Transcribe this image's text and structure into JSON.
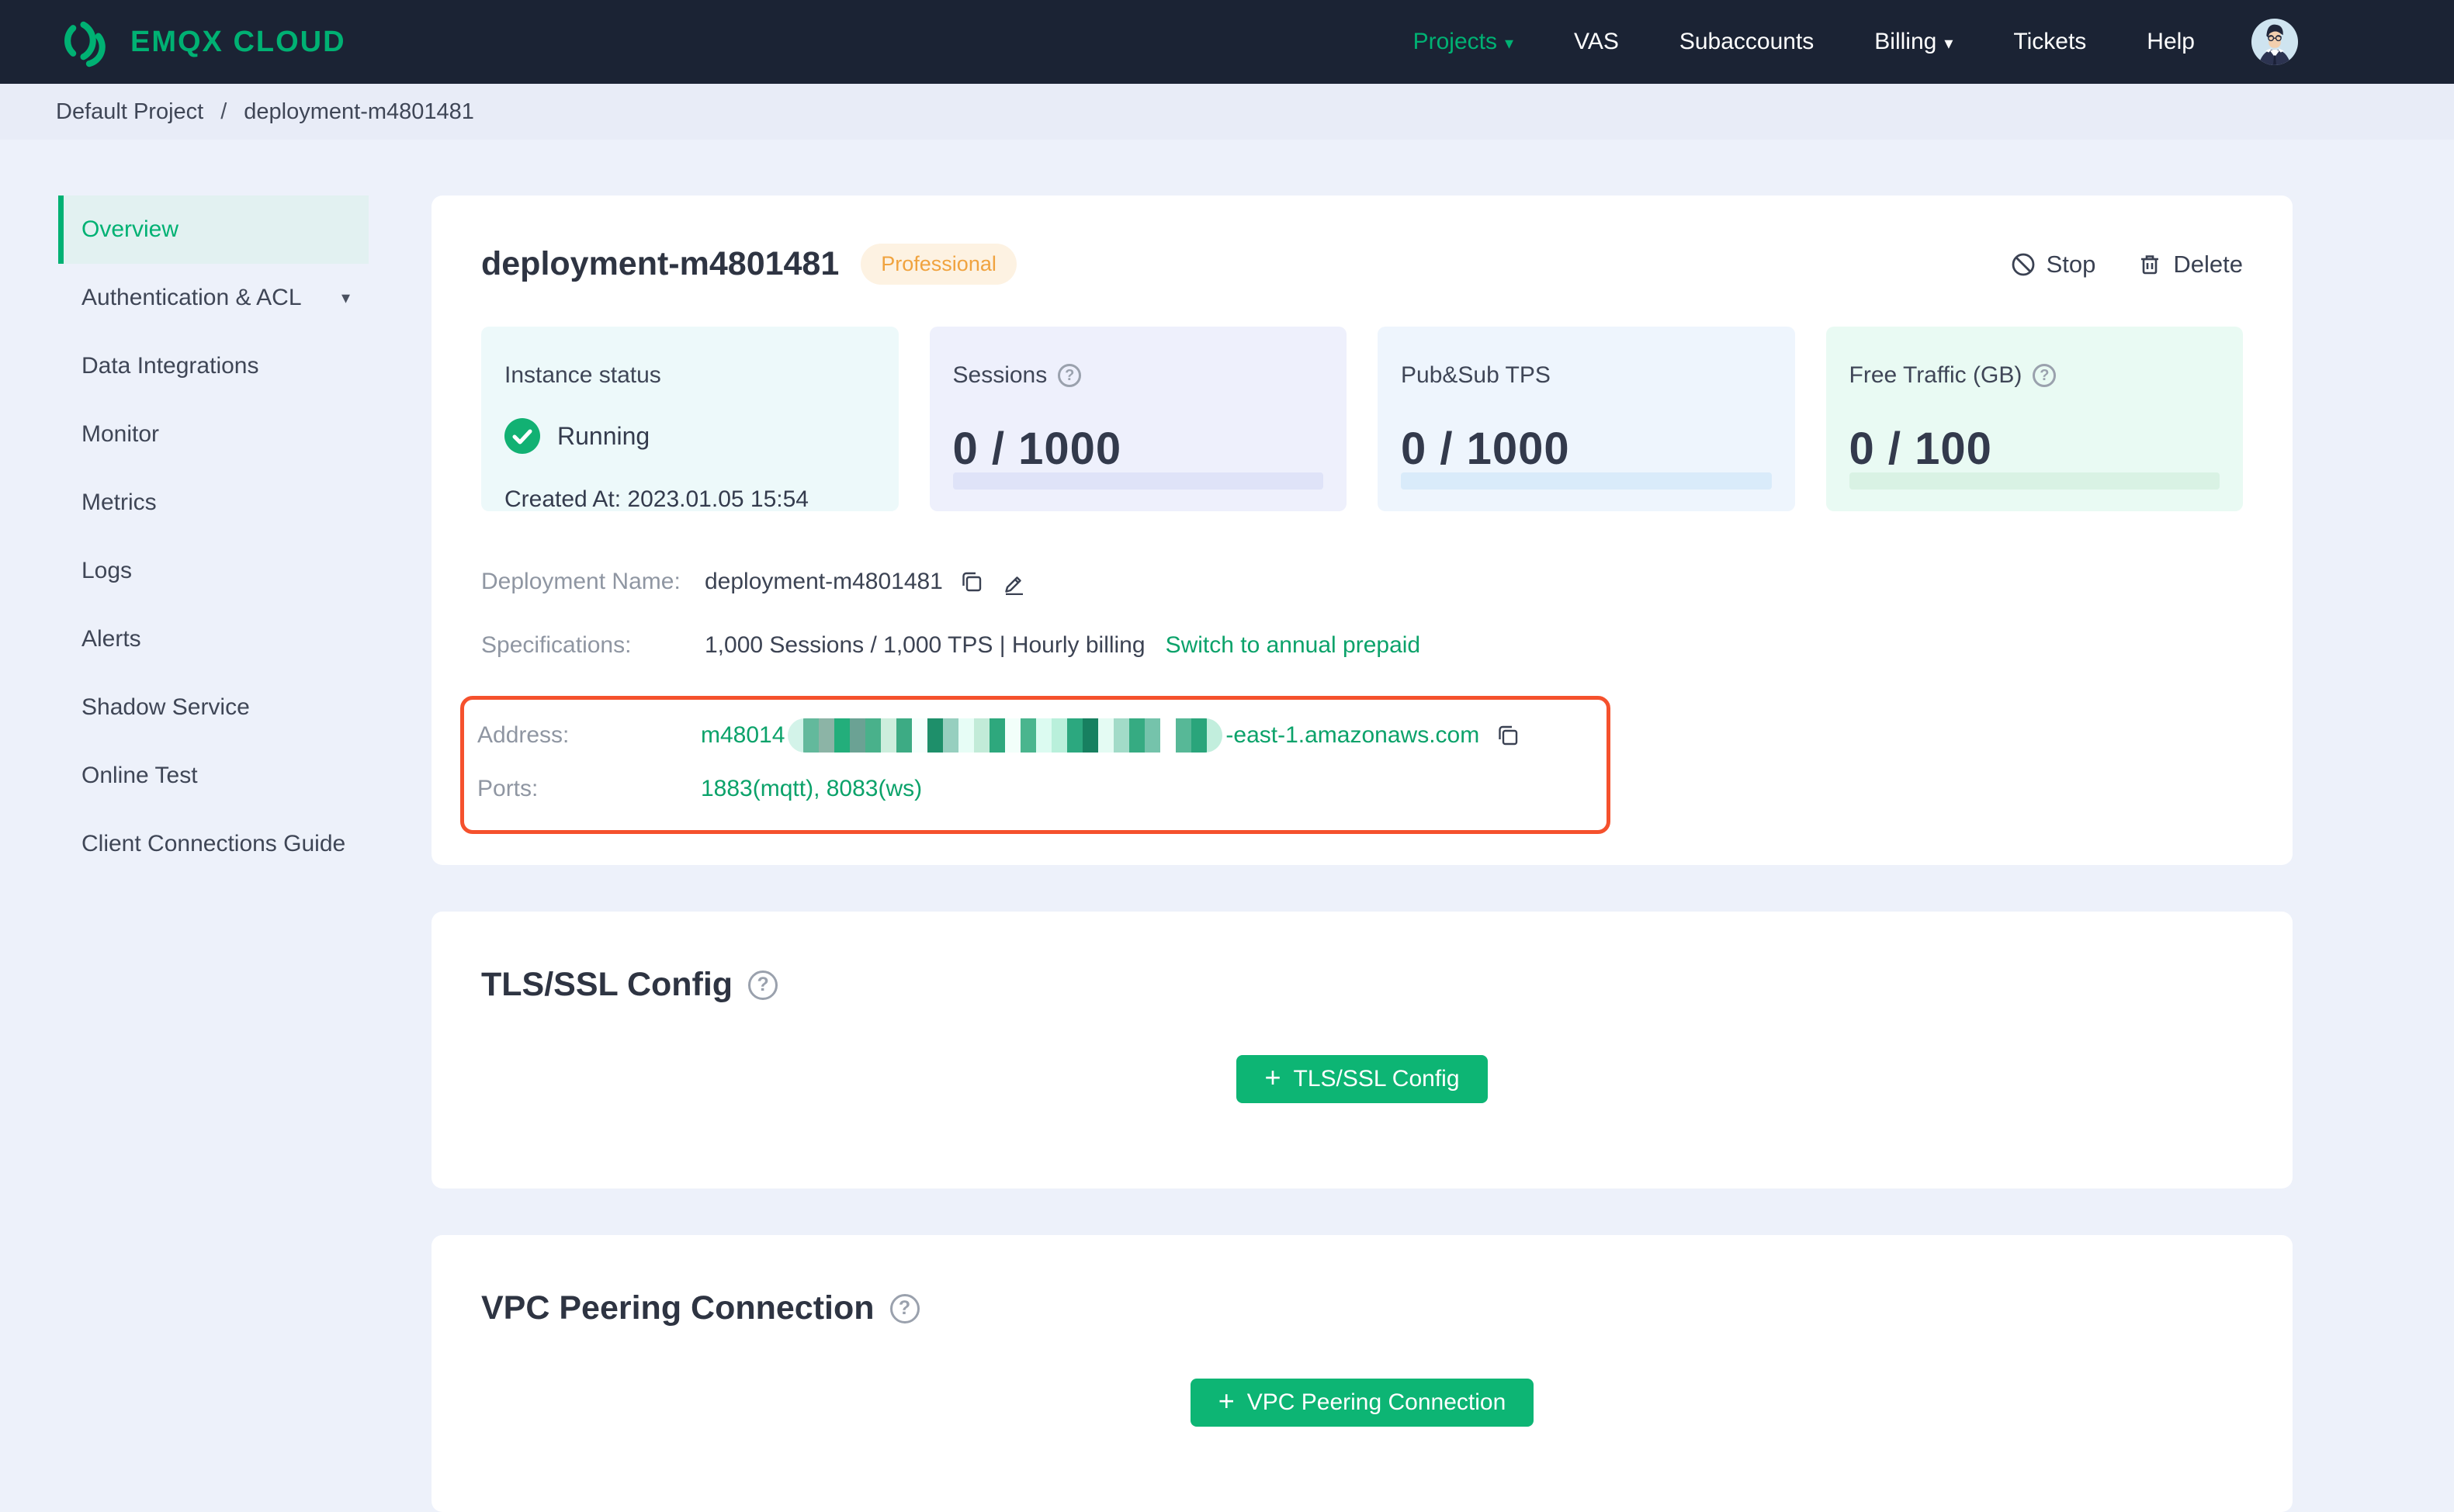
{
  "icons": {
    "help_glyph": "?",
    "caret_glyph": "▾",
    "breadcrumb_separator": "/",
    "plus_glyph": "+"
  },
  "colors": {
    "brand_green": "#00b173",
    "button_green": "#0db574",
    "link_green": "#0ba26a",
    "navbar_bg": "#1b2334",
    "page_bg": "#edf1fa",
    "breadcrumb_bg": "#e8ecf7",
    "active_item_bg": "#e2f1f1",
    "badge_bg": "#fdf2e2",
    "badge_text": "#f0a33f",
    "highlight_border": "#f5512d",
    "stat_bgs": [
      "#edf9fa",
      "#eef0fc",
      "#eef5fd",
      "#e9faf3"
    ],
    "stat_bars": [
      "#dfe3f8",
      "#d9ebfa",
      "#d9f2e4"
    ]
  },
  "brand": {
    "name": "EMQX CLOUD"
  },
  "nav": {
    "items": [
      {
        "id": "projects",
        "label": "Projects",
        "active": true,
        "caret": true
      },
      {
        "id": "vas",
        "label": "VAS"
      },
      {
        "id": "subaccounts",
        "label": "Subaccounts"
      },
      {
        "id": "billing",
        "label": "Billing",
        "caret": true
      },
      {
        "id": "tickets",
        "label": "Tickets"
      },
      {
        "id": "help",
        "label": "Help"
      }
    ]
  },
  "breadcrumb": {
    "project": "Default Project",
    "deployment": "deployment-m4801481"
  },
  "sidebar": {
    "items": [
      {
        "id": "overview",
        "label": "Overview",
        "active": true
      },
      {
        "id": "authentication-acl",
        "label": "Authentication & ACL",
        "caret": true
      },
      {
        "id": "data-integrations",
        "label": "Data Integrations"
      },
      {
        "id": "monitor",
        "label": "Monitor"
      },
      {
        "id": "metrics",
        "label": "Metrics"
      },
      {
        "id": "logs",
        "label": "Logs"
      },
      {
        "id": "alerts",
        "label": "Alerts"
      },
      {
        "id": "shadow-service",
        "label": "Shadow Service"
      },
      {
        "id": "online-test",
        "label": "Online Test"
      },
      {
        "id": "client-connections-guide",
        "label": "Client Connections Guide"
      }
    ]
  },
  "deployment": {
    "title": "deployment-m4801481",
    "plan_badge": "Professional",
    "actions": {
      "stop": "Stop",
      "delete": "Delete"
    },
    "stats": [
      {
        "label": "Instance status",
        "status": "Running",
        "created": "Created At: 2023.01.05 15:54"
      },
      {
        "label": "Sessions",
        "value": "0 / 1000"
      },
      {
        "label": "Pub&Sub TPS",
        "value": "0 / 1000"
      },
      {
        "label": "Free Traffic (GB)",
        "value": "0 / 100"
      }
    ],
    "details": {
      "name_label": "Deployment Name:",
      "name_value": "deployment-m4801481",
      "spec_label": "Specifications:",
      "spec_value": "1,000 Sessions / 1,000 TPS | Hourly billing",
      "spec_link": "Switch to annual prepaid",
      "address_label": "Address:",
      "address_prefix": "m48014",
      "address_suffix": "-east-1.amazonaws.com",
      "address_redacted_stripes": [
        "#d3f3e9",
        "#63b99c",
        "#8cb4a6",
        "#23ae7b",
        "#6ba294",
        "#49b18b",
        "#cdeedd",
        "#3dab84",
        "#f5fffc",
        "#1e8f6a",
        "#97cfbf",
        "#e7fdf6",
        "#c2ebd8",
        "#2ea87d",
        "#f2fffa",
        "#4ab58e",
        "#dcfbf1",
        "#b9f0db",
        "#2ca87f",
        "#178060",
        "#e4fbf3",
        "#a2dbc8",
        "#36ab82",
        "#75c3ab",
        "#ffffff",
        "#57b897",
        "#2aa57b",
        "#c2eedd"
      ],
      "ports_label": "Ports:",
      "ports_value": "1883(mqtt), 8083(ws)"
    }
  },
  "tls": {
    "title": "TLS/SSL Config",
    "button": "TLS/SSL Config"
  },
  "vpc": {
    "title": "VPC Peering Connection",
    "button": "VPC Peering Connection"
  }
}
